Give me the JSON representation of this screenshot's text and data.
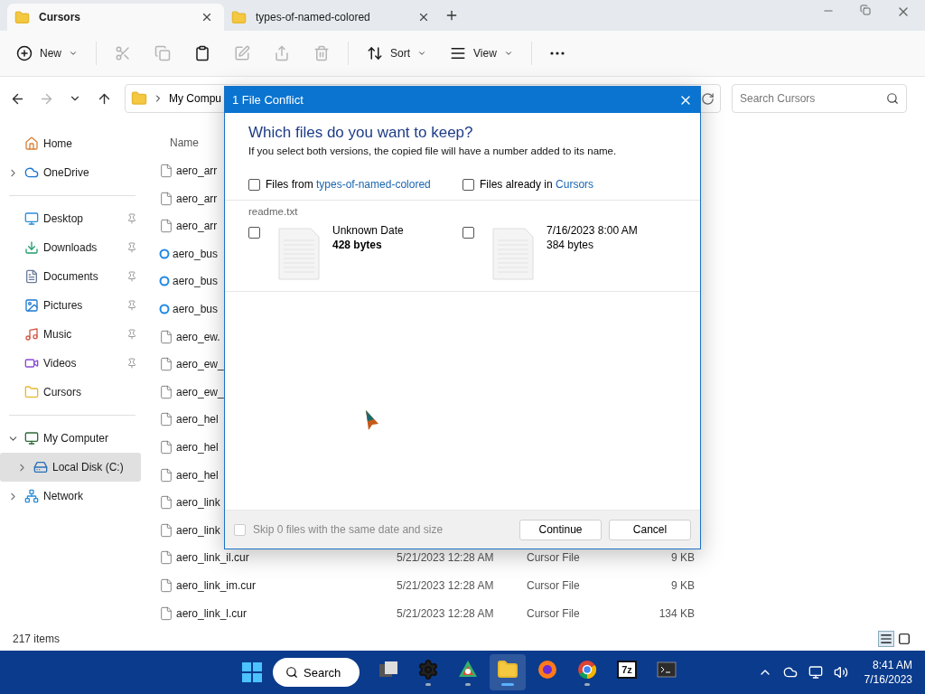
{
  "tabs": [
    {
      "title": "Cursors",
      "selected": true
    },
    {
      "title": "types-of-named-colored",
      "selected": false
    }
  ],
  "toolbar": [
    {
      "kind": "new",
      "label": "New",
      "disabled": false
    },
    {
      "kind": "cut",
      "disabled": true
    },
    {
      "kind": "copy",
      "disabled": true
    },
    {
      "kind": "paste",
      "disabled": false
    },
    {
      "kind": "rename",
      "disabled": true
    },
    {
      "kind": "share",
      "disabled": true
    },
    {
      "kind": "delete",
      "disabled": true
    },
    {
      "kind": "sort",
      "label": "Sort",
      "disabled": false
    },
    {
      "kind": "view",
      "label": "View",
      "disabled": false
    },
    {
      "kind": "more",
      "disabled": false
    }
  ],
  "navigation": [
    {
      "kind": "back",
      "disabled": false
    },
    {
      "kind": "forward",
      "disabled": true
    },
    {
      "kind": "recent",
      "disabled": false
    },
    {
      "kind": "up",
      "disabled": false
    }
  ],
  "address": {
    "crumb": "My Compu"
  },
  "search": {
    "placeholder": "Search Cursors"
  },
  "sidebar": {
    "sections": [
      [
        {
          "label": "Home",
          "kind": "home",
          "pinned": false,
          "selected": false
        },
        {
          "label": "OneDrive",
          "kind": "cloud",
          "pinned": false,
          "selected": false,
          "expanded": false
        }
      ],
      [
        {
          "label": "Desktop",
          "kind": "desktop",
          "pinned": true,
          "selected": false
        },
        {
          "label": "Downloads",
          "kind": "download",
          "pinned": true,
          "selected": false
        },
        {
          "label": "Documents",
          "kind": "documents",
          "pinned": true,
          "selected": false
        },
        {
          "label": "Pictures",
          "kind": "pictures",
          "pinned": true,
          "selected": false
        },
        {
          "label": "Music",
          "kind": "music",
          "pinned": true,
          "selected": false
        },
        {
          "label": "Videos",
          "kind": "videos",
          "pinned": true,
          "selected": false
        },
        {
          "label": "Cursors",
          "kind": "folder",
          "pinned": false,
          "selected": false
        }
      ],
      [
        {
          "label": "My Computer",
          "kind": "computer",
          "pinned": false,
          "selected": false,
          "expanded": true,
          "children": [
            {
              "label": "Local Disk (C:)",
              "kind": "disk",
              "pinned": false,
              "selected": true,
              "expanded": false
            }
          ]
        },
        {
          "label": "Network",
          "kind": "network",
          "pinned": false,
          "selected": false,
          "expanded": false
        }
      ]
    ]
  },
  "files": {
    "columns": [
      "Name"
    ],
    "rows": [
      {
        "name": "aero_arr",
        "kind": "file"
      },
      {
        "name": "aero_arr",
        "kind": "file"
      },
      {
        "name": "aero_arr",
        "kind": "file"
      },
      {
        "name": "aero_bus",
        "kind": "busy"
      },
      {
        "name": "aero_bus",
        "kind": "busy"
      },
      {
        "name": "aero_bus",
        "kind": "busy"
      },
      {
        "name": "aero_ew.",
        "kind": "file"
      },
      {
        "name": "aero_ew_",
        "kind": "file"
      },
      {
        "name": "aero_ew_",
        "kind": "file"
      },
      {
        "name": "aero_hel",
        "kind": "file"
      },
      {
        "name": "aero_hel",
        "kind": "file"
      },
      {
        "name": "aero_hel",
        "kind": "file"
      },
      {
        "name": "aero_link",
        "kind": "file"
      },
      {
        "name": "aero_link",
        "kind": "file"
      },
      {
        "name": "aero_link_il.cur",
        "kind": "file",
        "date": "5/21/2023 12:28 AM",
        "type": "Cursor File",
        "size": "9 KB"
      },
      {
        "name": "aero_link_im.cur",
        "kind": "file",
        "date": "5/21/2023 12:28 AM",
        "type": "Cursor File",
        "size": "9 KB"
      },
      {
        "name": "aero_link_l.cur",
        "kind": "file",
        "date": "5/21/2023 12:28 AM",
        "type": "Cursor File",
        "size": "134 KB"
      }
    ]
  },
  "status_bar": {
    "count": "217 items",
    "views": [
      {
        "kind": "details",
        "selected": true
      },
      {
        "kind": "tiles",
        "selected": false
      }
    ]
  },
  "dialog": {
    "title": "1 File Conflict",
    "heading": "Which files do you want to keep?",
    "subtitle": "If you select both versions, the copied file will have a number added to its name.",
    "sources": [
      {
        "prefix": "Files from ",
        "link": "types-of-named-colored",
        "checked": false
      },
      {
        "prefix": "Files already in ",
        "link": "Cursors",
        "checked": false
      }
    ],
    "conflicts": [
      {
        "file": "readme.txt",
        "versions": [
          {
            "date": "Unknown Date",
            "size": "428 bytes",
            "larger": true,
            "checked": false
          },
          {
            "date": "7/16/2023 8:00 AM",
            "size": "384 bytes",
            "larger": false,
            "checked": false
          }
        ]
      }
    ],
    "skip": {
      "label": "Skip 0 files with the same date and size",
      "checked": false,
      "disabled": true
    },
    "buttons": [
      "Continue",
      "Cancel"
    ]
  },
  "taskbar": {
    "search": "Search",
    "apps": [
      {
        "kind": "taskview",
        "running": false,
        "selected": false
      },
      {
        "kind": "settings",
        "running": true,
        "selected": false
      },
      {
        "kind": "photos",
        "running": true,
        "selected": false
      },
      {
        "kind": "explorer",
        "running": true,
        "selected": true
      },
      {
        "kind": "firefox",
        "running": false,
        "selected": false
      },
      {
        "kind": "chrome",
        "running": true,
        "selected": false
      },
      {
        "kind": "archiver",
        "label": "7z",
        "running": false,
        "selected": false
      },
      {
        "kind": "terminal",
        "running": false,
        "selected": false
      }
    ],
    "time": "8:41 AM",
    "date": "7/16/2023"
  }
}
